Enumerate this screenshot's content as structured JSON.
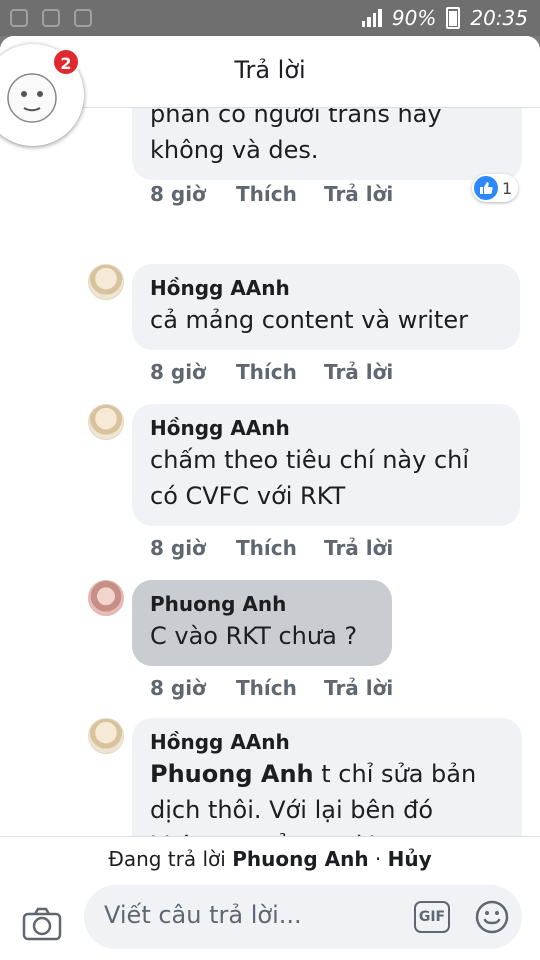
{
  "status_bar": {
    "battery": "90%",
    "time": "20:35"
  },
  "header": {
    "title": "Trả lời"
  },
  "chathead": {
    "badge": "2"
  },
  "comments": [
    {
      "lines": [
        "phần có người trans hay",
        "không và des."
      ],
      "time": "8 giờ",
      "like": "Thích",
      "reply": "Trả lời",
      "reaction_count": "1"
    },
    {
      "name": "Hồngg AAnh",
      "lines": [
        "cả mảng content và writer"
      ],
      "time": "8 giờ",
      "like": "Thích",
      "reply": "Trả lời"
    },
    {
      "name": "Hồngg AAnh",
      "lines": [
        "chấm theo tiêu chí này chỉ",
        "có CVFC với RKT"
      ],
      "time": "8 giờ",
      "like": "Thích",
      "reply": "Trả lời"
    },
    {
      "name": "Phuong Anh",
      "lines": [
        "C vào RKT chưa ?"
      ],
      "time": "8 giờ",
      "like": "Thích",
      "reply": "Trả lời"
    },
    {
      "name": "Hồngg AAnh",
      "mention": "Phuong Anh",
      "lines": [
        " t chỉ sửa bản",
        "dịch thôi. Với lại bên đó",
        "không tuyển người."
      ]
    }
  ],
  "footer": {
    "replying_prefix": "Đang trả lời",
    "replying_to": "Phuong Anh",
    "separator": "·",
    "cancel": "Hủy",
    "placeholder": "Viết câu trả lời...",
    "gif_label": "GIF"
  }
}
